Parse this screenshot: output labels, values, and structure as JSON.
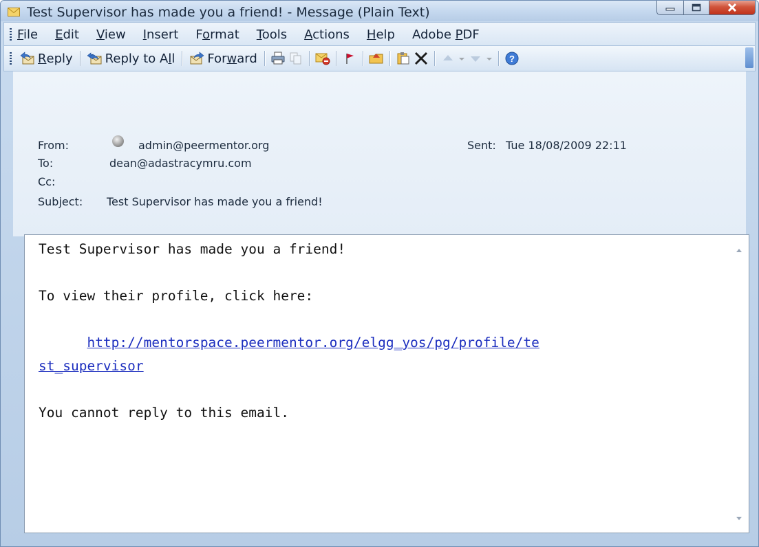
{
  "window": {
    "title": "Test Supervisor has made you a friend! - Message (Plain Text)"
  },
  "menu": [
    {
      "pre": "",
      "acc": "F",
      "post": "ile"
    },
    {
      "pre": "",
      "acc": "E",
      "post": "dit"
    },
    {
      "pre": "",
      "acc": "V",
      "post": "iew"
    },
    {
      "pre": "",
      "acc": "I",
      "post": "nsert"
    },
    {
      "pre": "F",
      "acc": "o",
      "post": "rmat"
    },
    {
      "pre": "",
      "acc": "T",
      "post": "ools"
    },
    {
      "pre": "",
      "acc": "A",
      "post": "ctions"
    },
    {
      "pre": "",
      "acc": "H",
      "post": "elp"
    },
    {
      "pre": "Adobe ",
      "acc": "P",
      "post": "DF"
    }
  ],
  "toolbar": {
    "reply": {
      "pre": "",
      "acc": "R",
      "post": "eply"
    },
    "reply_all": {
      "pre": "Reply to A",
      "acc": "l",
      "post": "l"
    },
    "forward": {
      "pre": "For",
      "acc": "w",
      "post": "ard"
    }
  },
  "header": {
    "from_label": "From:",
    "from_value": "admin@peermentor.org",
    "to_label": "To:",
    "to_value": "dean@adastracymru.com",
    "cc_label": "Cc:",
    "cc_value": "",
    "subject_label": "Subject:",
    "subject_value": "Test Supervisor has made you a friend!",
    "sent_label": "Sent:",
    "sent_value": "Tue 18/08/2009 22:11"
  },
  "body": {
    "line1": "Test Supervisor has made you a friend!",
    "line2": "To view their profile, click here:",
    "link_part1": "http://mentorspace.peermentor.org/elgg_yos/pg/profile/te",
    "link_part2": "st_supervisor",
    "line3": "You cannot reply to this email."
  },
  "colors": {
    "link": "#1d2fbf",
    "close_button": "#c0311a",
    "flag": "#c8102e"
  }
}
